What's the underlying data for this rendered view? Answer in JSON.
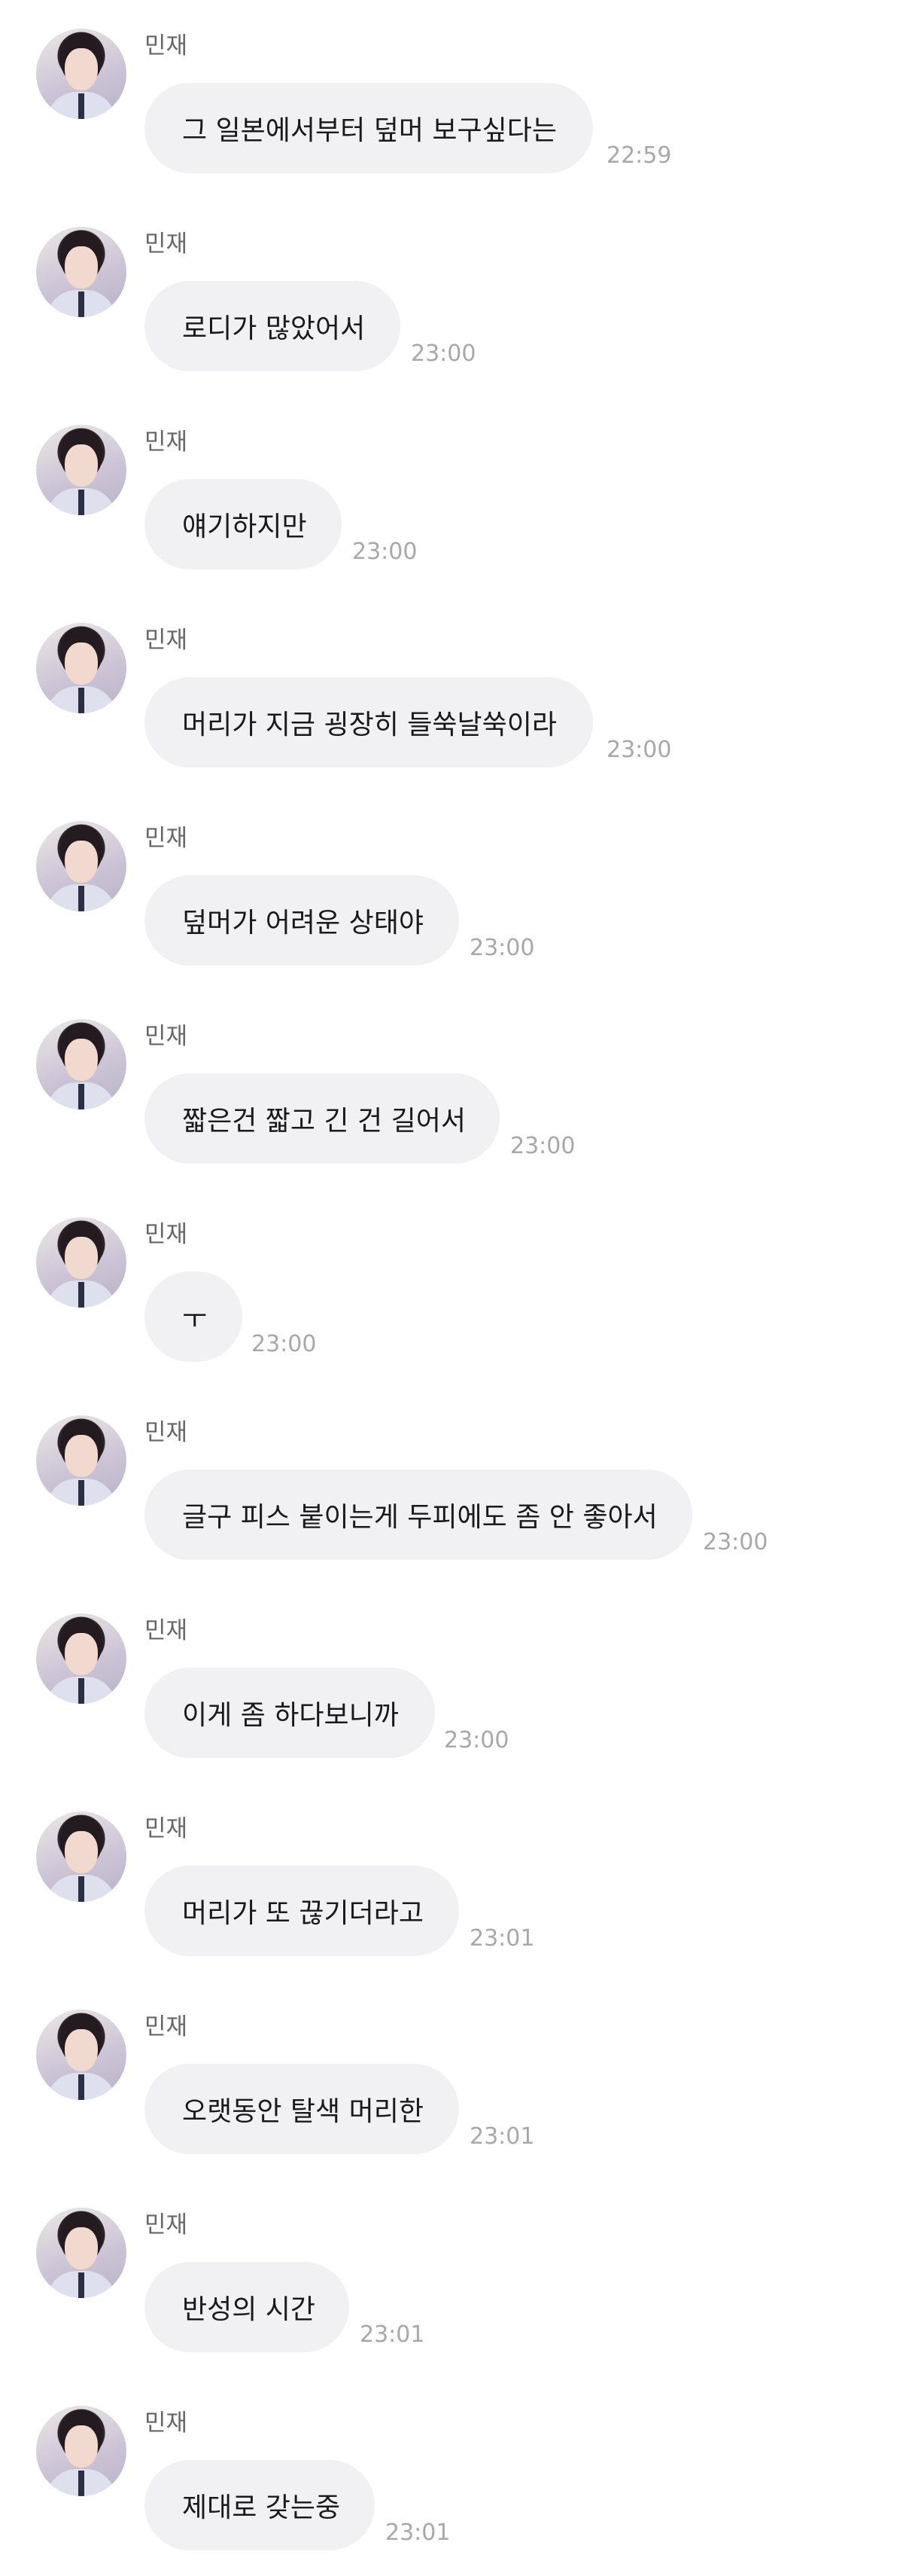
{
  "sender_name": "민재",
  "messages": [
    {
      "text": "그 일본에서부터 덮머 보구싶다는",
      "time": "22:59"
    },
    {
      "text": "로디가 많았어서",
      "time": "23:00"
    },
    {
      "text": "얘기하지만",
      "time": "23:00"
    },
    {
      "text": "머리가 지금 굉장히 들쑥날쑥이라",
      "time": "23:00"
    },
    {
      "text": "덮머가 어려운 상태야",
      "time": "23:00"
    },
    {
      "text": "짧은건 짧고 긴 건 길어서",
      "time": "23:00"
    },
    {
      "text": "ㅜ",
      "time": "23:00"
    },
    {
      "text": "글구 피스 붙이는게 두피에도 좀 안 좋아서",
      "time": "23:00"
    },
    {
      "text": "이게 좀 하다보니까",
      "time": "23:00"
    },
    {
      "text": "머리가 또 끊기더라고",
      "time": "23:01"
    },
    {
      "text": "오랫동안 탈색 머리한",
      "time": "23:01"
    },
    {
      "text": "반성의 시간",
      "time": "23:01"
    },
    {
      "text": "제대로 갖는중",
      "time": "23:01"
    }
  ]
}
